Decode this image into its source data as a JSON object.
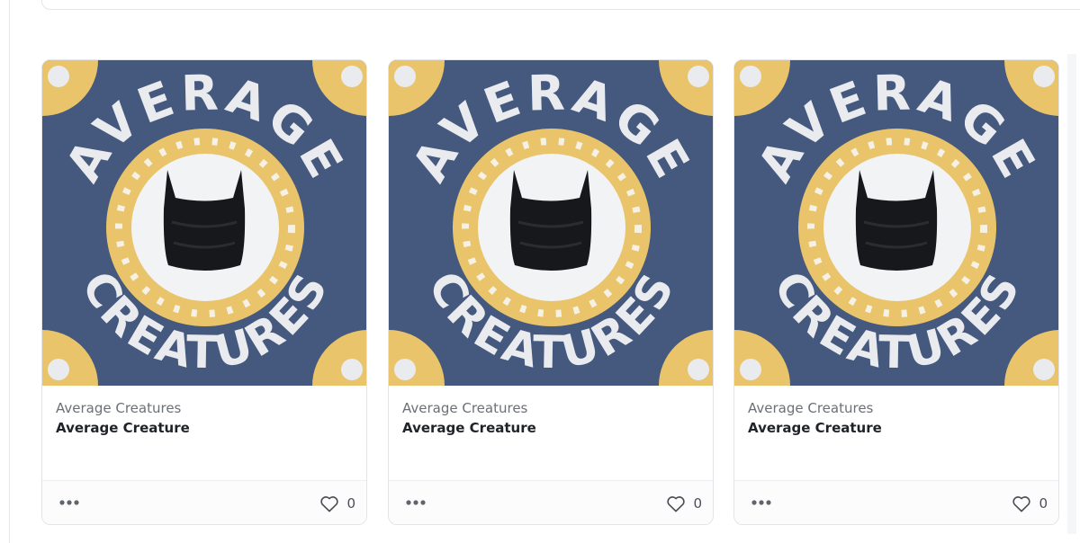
{
  "colors": {
    "art_background": "#45597f",
    "art_frame": "#e9c46a",
    "clay_white": "#e9ebef",
    "creature": "#17181b"
  },
  "cards": [
    {
      "art": {
        "top_word": "AVERAGE",
        "bottom_word": "CREATURES"
      },
      "collection": "Average Creatures",
      "name": "Average Creature",
      "more_icon": "more-dots-icon",
      "like_icon": "heart-outline-icon",
      "likes": "0"
    },
    {
      "art": {
        "top_word": "AVERAGE",
        "bottom_word": "CREATURES"
      },
      "collection": "Average Creatures",
      "name": "Average Creature",
      "more_icon": "more-dots-icon",
      "like_icon": "heart-outline-icon",
      "likes": "0"
    },
    {
      "art": {
        "top_word": "AVERAGE",
        "bottom_word": "CREATURES"
      },
      "collection": "Average Creatures",
      "name": "Average Creature",
      "more_icon": "more-dots-icon",
      "like_icon": "heart-outline-icon",
      "likes": "0"
    }
  ]
}
